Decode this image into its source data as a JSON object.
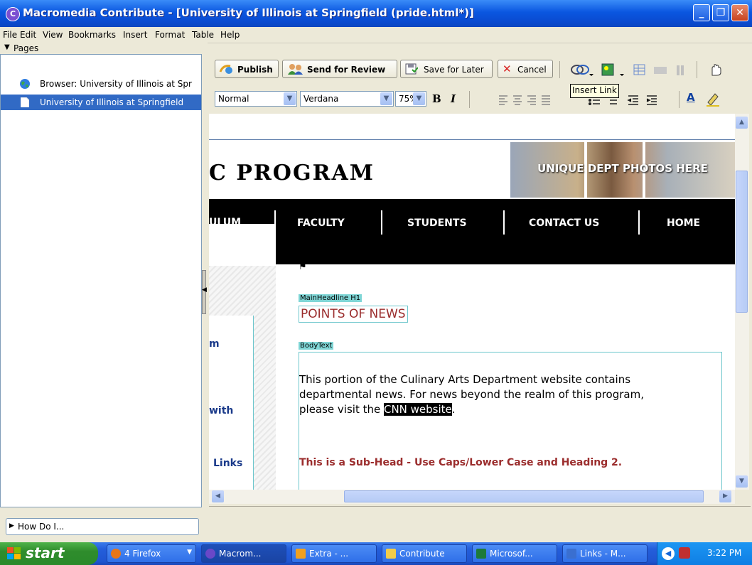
{
  "window": {
    "title": "Macromedia Contribute - [University of Illinois at Springfield (pride.html*)]",
    "controls": {
      "minimize": "_",
      "maximize": "❐",
      "close": "✕"
    }
  },
  "menu": [
    "File",
    "Edit",
    "View",
    "Bookmarks",
    "Insert",
    "Format",
    "Table",
    "Help"
  ],
  "sidebar": {
    "pages_header": "Pages",
    "items": [
      {
        "label": "Browser: University of Illinois at Spr",
        "icon": "globe-icon",
        "selected": false
      },
      {
        "label": "University of Illinois at Springfield",
        "icon": "page-icon",
        "selected": true
      }
    ],
    "how_do_i": "How Do I..."
  },
  "toolbar": {
    "publish": "Publish",
    "send_for_review": "Send for Review",
    "save_for_later": "Save for Later",
    "cancel": "Cancel",
    "tooltip": "Insert Link"
  },
  "format_bar": {
    "style": "Normal",
    "font": "Verdana",
    "size": "75%",
    "bold": "B",
    "italic": "I",
    "text_color": "A"
  },
  "page": {
    "program_title": "C PROGRAM",
    "photos_text": "UNIQUE DEPT PHOTOS HERE",
    "nav": [
      "ULUM",
      "FACULTY",
      "STUDENTS",
      "CONTACT US",
      "HOME"
    ],
    "side_links": [
      "m",
      "with",
      "Links"
    ],
    "headline_tag": "MainHeadline H1",
    "headline": "POINTS OF NEWS",
    "body_tag": "BodyText",
    "body_line1": "This portion of the Culinary Arts Department website contains",
    "body_line2": "departmental news.  For news beyond the realm of this program,",
    "body_line3_prefix": "please visit the ",
    "body_link": "CNN website",
    "body_line3_suffix": ".",
    "subhead": "This is a Sub-Head - Use Caps/Lower Case and Heading 2."
  },
  "taskbar": {
    "start": "start",
    "tasks": [
      {
        "label": "4 Firefox",
        "color": "#e8761a"
      },
      {
        "label": "Macrom...",
        "color": "#6a48c8"
      },
      {
        "label": "Extra - ...",
        "color": "#f0a020"
      },
      {
        "label": "Contribute",
        "color": "#f2cc4a"
      },
      {
        "label": "Microsof...",
        "color": "#1d7a3a"
      },
      {
        "label": "Links - M...",
        "color": "#3a6fd0"
      }
    ],
    "clock": "3:22 PM"
  },
  "colors": {
    "title_blue": "#0a56e0",
    "selected_row": "#316ac5",
    "headline_red": "#9b2d2d",
    "tag_teal": "#7fd6d6",
    "nav_black": "#000000"
  }
}
